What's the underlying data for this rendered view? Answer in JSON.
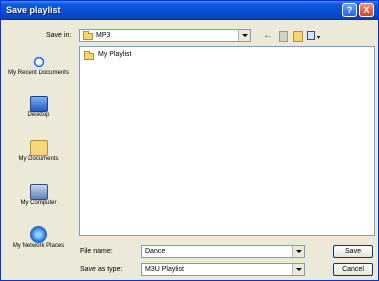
{
  "titlebar": {
    "title": "Save playlist",
    "help_label": "?",
    "close_label": "X"
  },
  "toolbar": {
    "save_in_label": "Save in:",
    "current_folder": "MP3",
    "back_glyph": "←",
    "view_glyph": "▾",
    "icons": [
      "back-icon",
      "up-folder-icon",
      "new-folder-icon",
      "views-menu-icon"
    ]
  },
  "places": [
    {
      "label": "My Recent Documents",
      "icon": "recent-documents-icon"
    },
    {
      "label": "Desktop",
      "icon": "desktop-icon"
    },
    {
      "label": "My Documents",
      "icon": "my-documents-icon"
    },
    {
      "label": "My Computer",
      "icon": "my-computer-icon"
    },
    {
      "label": "My Network Places",
      "icon": "network-places-icon"
    }
  ],
  "files": [
    {
      "name": "My Playlist",
      "icon": "folder-icon"
    }
  ],
  "form": {
    "file_name_label": "File name:",
    "file_name_value": "Dance",
    "save_as_type_label": "Save as type:",
    "save_as_type_value": "M3U Playlist",
    "save_button": "Save",
    "cancel_button": "Cancel"
  },
  "colors": {
    "titlebar": "#0b4fd5",
    "window_bg": "#ece9d8",
    "close_button": "#d6401c"
  }
}
